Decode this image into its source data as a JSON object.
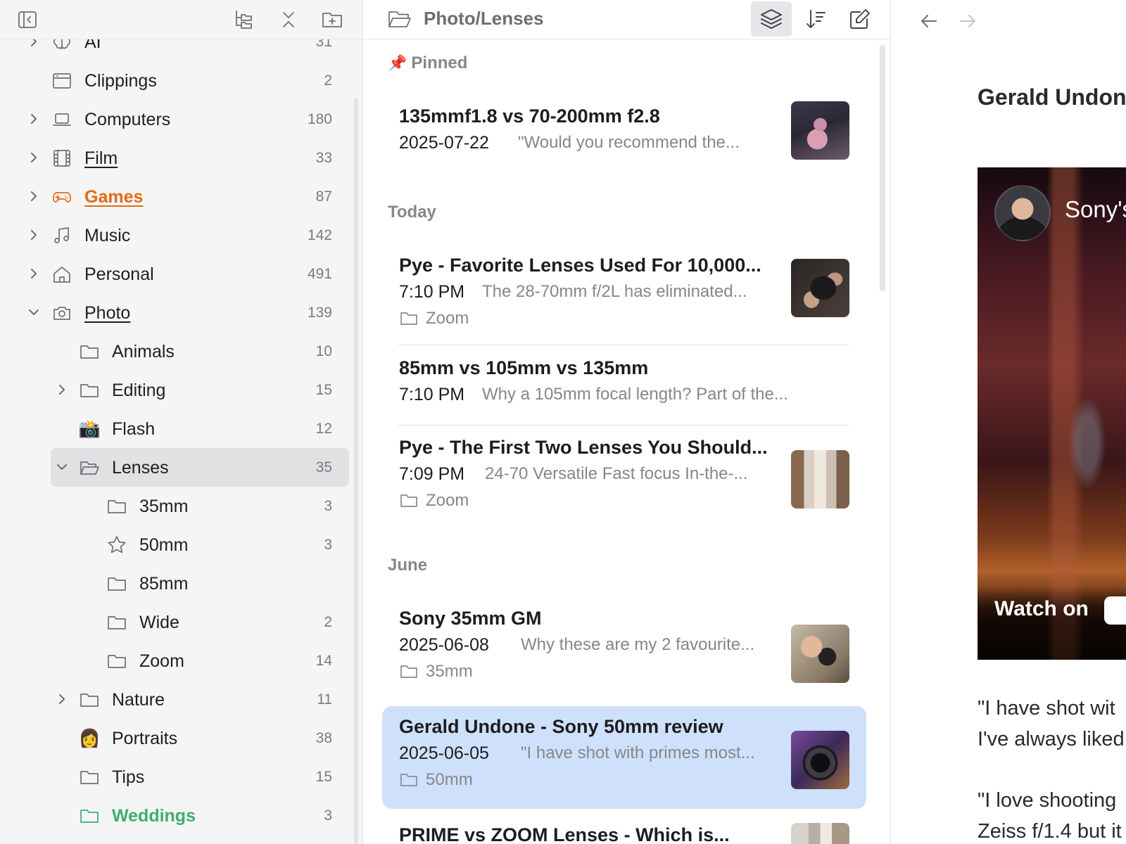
{
  "sidebar": {
    "toolbar": {
      "toggle_sidebar_icon": "sidebar-left-icon",
      "tree_icon": "folder-tree-icon",
      "collapse_icon": "collapse-all-icon",
      "new_folder_icon": "folder-plus-icon"
    },
    "items": [
      {
        "label": "AI",
        "count": "31",
        "icon": "brain-icon"
      },
      {
        "label": "Clippings",
        "count": "2",
        "icon": "browser-window-icon"
      },
      {
        "label": "Computers",
        "count": "180",
        "icon": "laptop-icon"
      },
      {
        "label": "Film",
        "count": "33",
        "icon": "film-icon"
      },
      {
        "label": "Games",
        "count": "87",
        "icon": "gamepad-icon",
        "color": "#e26b16"
      },
      {
        "label": "Music",
        "count": "142",
        "icon": "music-note-icon"
      },
      {
        "label": "Personal",
        "count": "491",
        "icon": "home-icon"
      },
      {
        "label": "Photo",
        "count": "139",
        "icon": "camera-icon"
      },
      {
        "label": "Animals",
        "count": "10",
        "icon": "folder-icon"
      },
      {
        "label": "Editing",
        "count": "15",
        "icon": "folder-icon"
      },
      {
        "label": "Flash",
        "count": "12",
        "icon": "📸"
      },
      {
        "label": "Lenses",
        "count": "35",
        "icon": "folder-open-icon"
      },
      {
        "label": "35mm",
        "count": "3",
        "icon": "folder-icon"
      },
      {
        "label": "50mm",
        "count": "3",
        "icon": "star-icon"
      },
      {
        "label": "85mm",
        "count": "",
        "icon": "folder-icon"
      },
      {
        "label": "Wide",
        "count": "2",
        "icon": "folder-icon"
      },
      {
        "label": "Zoom",
        "count": "14",
        "icon": "folder-icon"
      },
      {
        "label": "Nature",
        "count": "11",
        "icon": "folder-icon"
      },
      {
        "label": "Portraits",
        "count": "38",
        "icon": "👩"
      },
      {
        "label": "Tips",
        "count": "15",
        "icon": "folder-icon"
      },
      {
        "label": "Weddings",
        "count": "3",
        "icon": "folder-icon",
        "color": "#3fae6f"
      }
    ]
  },
  "notelist": {
    "path": "Photo/Lenses",
    "sections": {
      "pinned": "Pinned",
      "pinned_emoji": "📌",
      "today": "Today",
      "june": "June"
    },
    "notes": [
      {
        "title": "135mmf1.8 vs 70-200mm f2.8",
        "date": "2025-07-22",
        "snippet": "\"Would you recommend the...",
        "folder": ""
      },
      {
        "title": "Pye - Favorite Lenses Used For 10,000...",
        "date": "7:10 PM",
        "snippet": "The 28-70mm f/2L has eliminated...",
        "folder": "Zoom"
      },
      {
        "title": "85mm vs 105mm vs 135mm",
        "date": "7:10 PM",
        "snippet": "Why a 105mm focal length? Part of the...",
        "folder": ""
      },
      {
        "title": "Pye - The First Two Lenses You Should...",
        "date": "7:09 PM",
        "snippet": "24-70 Versatile Fast focus In-the-...",
        "folder": "Zoom"
      },
      {
        "title": "Sony 35mm GM",
        "date": "2025-06-08",
        "snippet": "Why these are my 2 favourite...",
        "folder": "35mm"
      },
      {
        "title": "Gerald Undone - Sony 50mm review",
        "date": "2025-06-05",
        "snippet": "\"I have shot with primes most...",
        "folder": "50mm"
      },
      {
        "title": "PRIME vs ZOOM Lenses - Which is...",
        "date": "",
        "snippet": "",
        "folder": ""
      }
    ]
  },
  "detail": {
    "title": "Gerald Undone",
    "video_title": "Sony's",
    "watch_label": "Watch on",
    "paragraphs": [
      "\"I have shot wit",
      "I've always liked",
      "\"I love shooting",
      "Zeiss f/1.4 but it"
    ]
  },
  "colors": {
    "selected_note": "#cfe0fb",
    "selected_folder": "#e1e1e4",
    "games": "#e26b16",
    "weddings": "#3fae6f"
  }
}
